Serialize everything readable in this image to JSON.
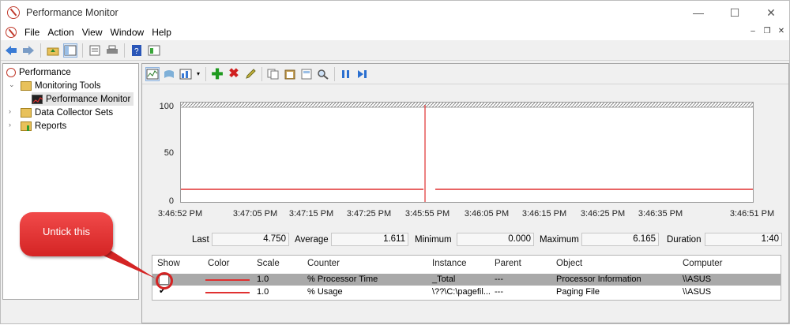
{
  "window": {
    "title": "Performance Monitor",
    "controls": [
      "—",
      "☐",
      "✕"
    ]
  },
  "menu": {
    "items": [
      "File",
      "Action",
      "View",
      "Window",
      "Help"
    ],
    "mdi_controls": [
      "–",
      "❐",
      "✕"
    ]
  },
  "tree": {
    "root": "Performance",
    "monitoring_tools": "Monitoring Tools",
    "performance_monitor": "Performance Monitor",
    "data_collector_sets": "Data Collector Sets",
    "reports": "Reports"
  },
  "graph": {
    "y_ticks": [
      "100",
      "50",
      "0"
    ],
    "x_ticks": [
      "3:46:52 PM",
      "3:47:05 PM",
      "3:47:15 PM",
      "3:47:25 PM",
      "3:45:55 PM",
      "3:46:05 PM",
      "3:46:15 PM",
      "3:46:25 PM",
      "3:46:35 PM",
      "3:46:51 PM"
    ],
    "line_color": "#e03030",
    "cursor_color": "#e03030"
  },
  "stats": {
    "last_label": "Last",
    "last_value": "4.750",
    "average_label": "Average",
    "average_value": "1.611",
    "minimum_label": "Minimum",
    "minimum_value": "0.000",
    "maximum_label": "Maximum",
    "maximum_value": "6.165",
    "duration_label": "Duration",
    "duration_value": "1:40"
  },
  "table": {
    "headers": [
      "Show",
      "Color",
      "Scale",
      "Counter",
      "Instance",
      "Parent",
      "Object",
      "Computer"
    ],
    "rows": [
      {
        "scale": "1.0",
        "counter": "% Processor Time",
        "instance": "_Total",
        "parent": "---",
        "object": "Processor Information",
        "computer": "\\\\ASUS",
        "checked": false
      },
      {
        "scale": "1.0",
        "counter": "% Usage",
        "instance": "\\??\\C:\\pagefil...",
        "parent": "---",
        "object": "Paging File",
        "computer": "\\\\ASUS",
        "checked": true
      }
    ]
  },
  "annotation": {
    "callout_text": "Untick this",
    "color": "#d42424"
  }
}
